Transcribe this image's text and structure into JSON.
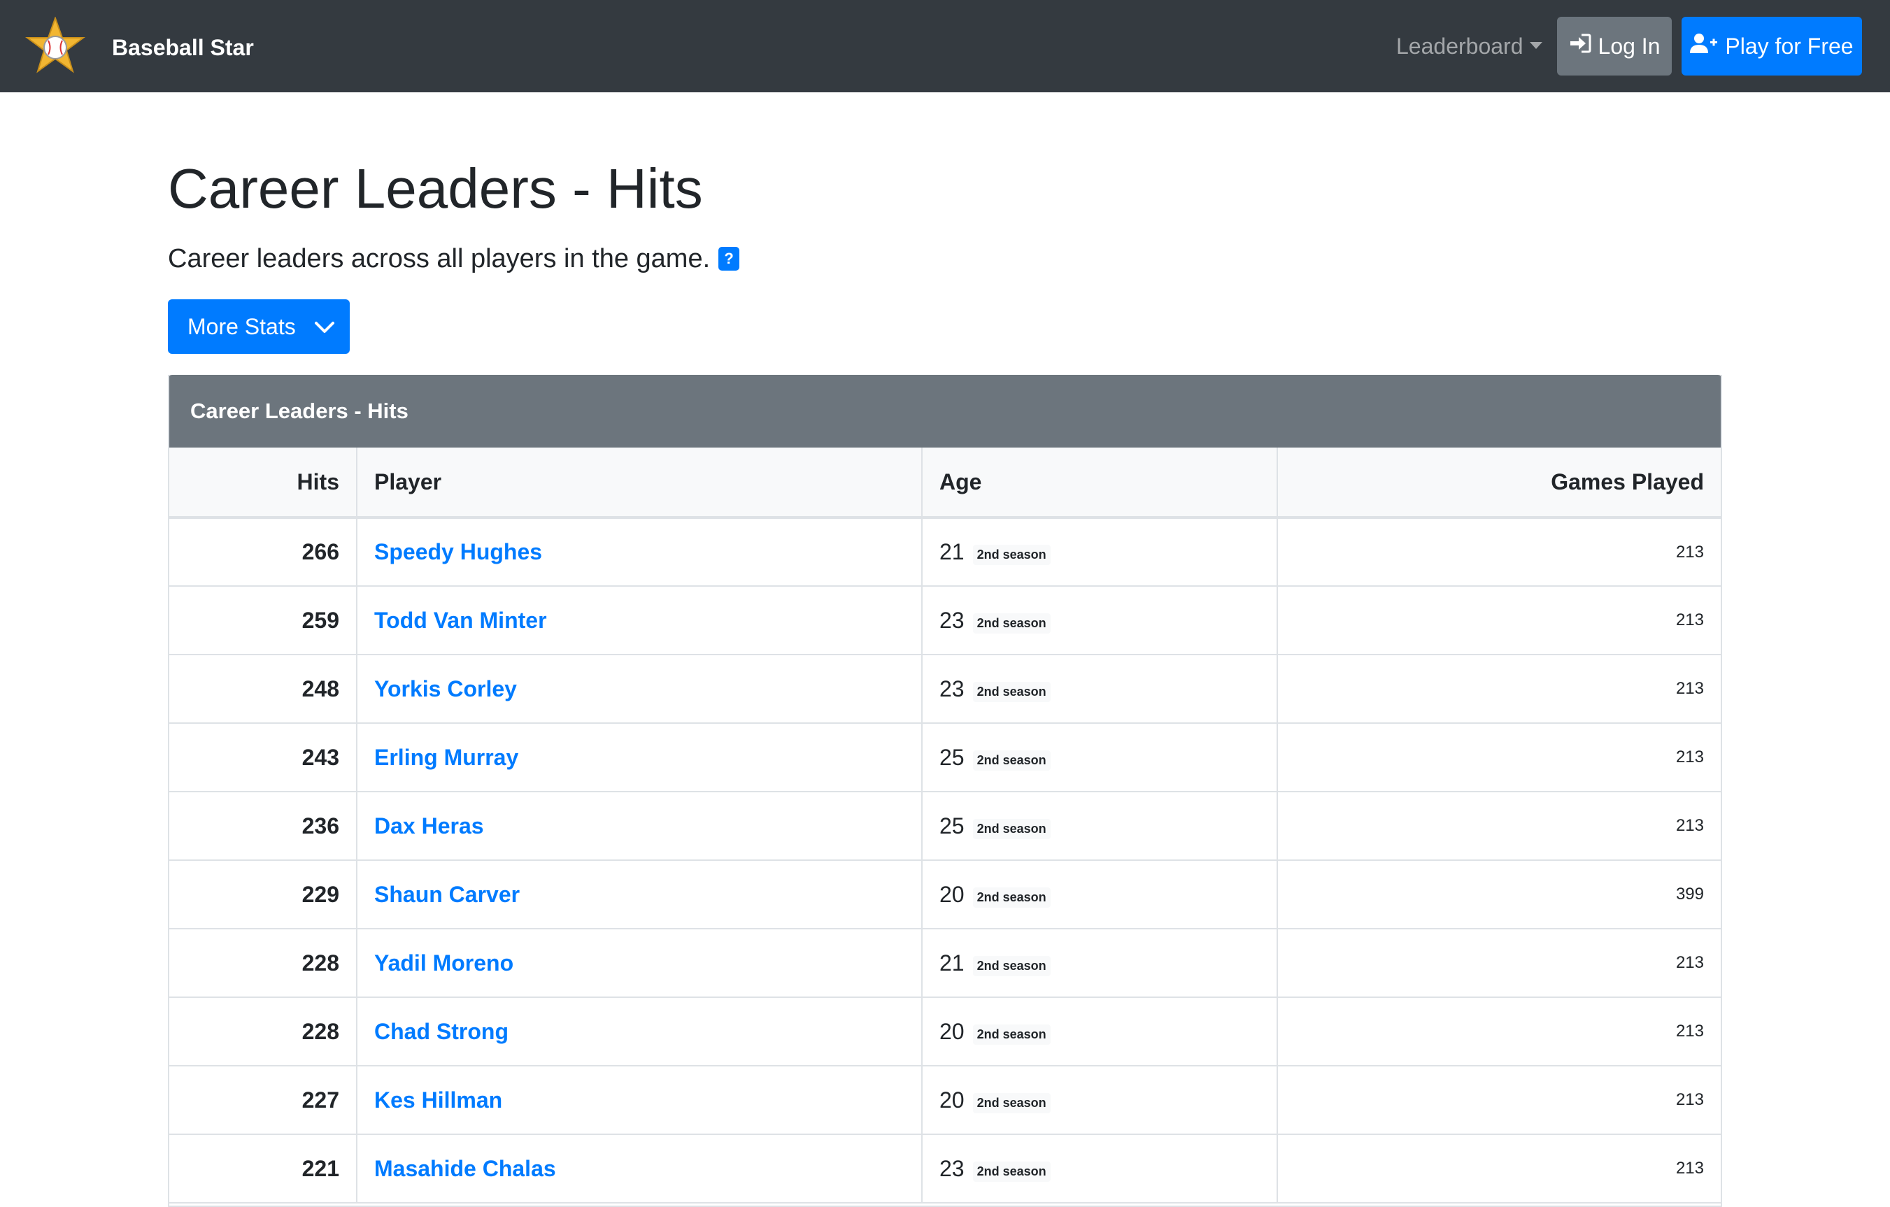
{
  "navbar": {
    "brand_name": "Baseball Star",
    "leaderboard_label": "Leaderboard",
    "login_label": "Log In",
    "play_label": "Play for Free"
  },
  "page": {
    "title": "Career Leaders - Hits",
    "subtitle": "Career leaders across all players in the game.",
    "help_badge": "?",
    "more_stats_label": "More Stats"
  },
  "card": {
    "header": "Career Leaders - Hits",
    "columns": [
      "Hits",
      "Player",
      "Age",
      "Games Played"
    ],
    "rows": [
      {
        "hits": "266",
        "player": "Speedy Hughes",
        "age": "21",
        "season": "2nd season",
        "games": "213"
      },
      {
        "hits": "259",
        "player": "Todd Van Minter",
        "age": "23",
        "season": "2nd season",
        "games": "213"
      },
      {
        "hits": "248",
        "player": "Yorkis Corley",
        "age": "23",
        "season": "2nd season",
        "games": "213"
      },
      {
        "hits": "243",
        "player": "Erling Murray",
        "age": "25",
        "season": "2nd season",
        "games": "213"
      },
      {
        "hits": "236",
        "player": "Dax Heras",
        "age": "25",
        "season": "2nd season",
        "games": "213"
      },
      {
        "hits": "229",
        "player": "Shaun Carver",
        "age": "20",
        "season": "2nd season",
        "games": "399"
      },
      {
        "hits": "228",
        "player": "Yadil Moreno",
        "age": "21",
        "season": "2nd season",
        "games": "213"
      },
      {
        "hits": "228",
        "player": "Chad Strong",
        "age": "20",
        "season": "2nd season",
        "games": "213"
      },
      {
        "hits": "227",
        "player": "Kes Hillman",
        "age": "20",
        "season": "2nd season",
        "games": "213"
      },
      {
        "hits": "221",
        "player": "Masahide Chalas",
        "age": "23",
        "season": "2nd season",
        "games": "213"
      }
    ]
  },
  "colors": {
    "navbar_bg": "#343a40",
    "primary": "#007bff",
    "secondary": "#6c757d",
    "logo_star": "#f2b632"
  },
  "icons": {
    "logo": "baseball-star-icon",
    "login": "sign-in-icon",
    "play": "user-plus-icon",
    "more": "chevron-down-icon"
  }
}
